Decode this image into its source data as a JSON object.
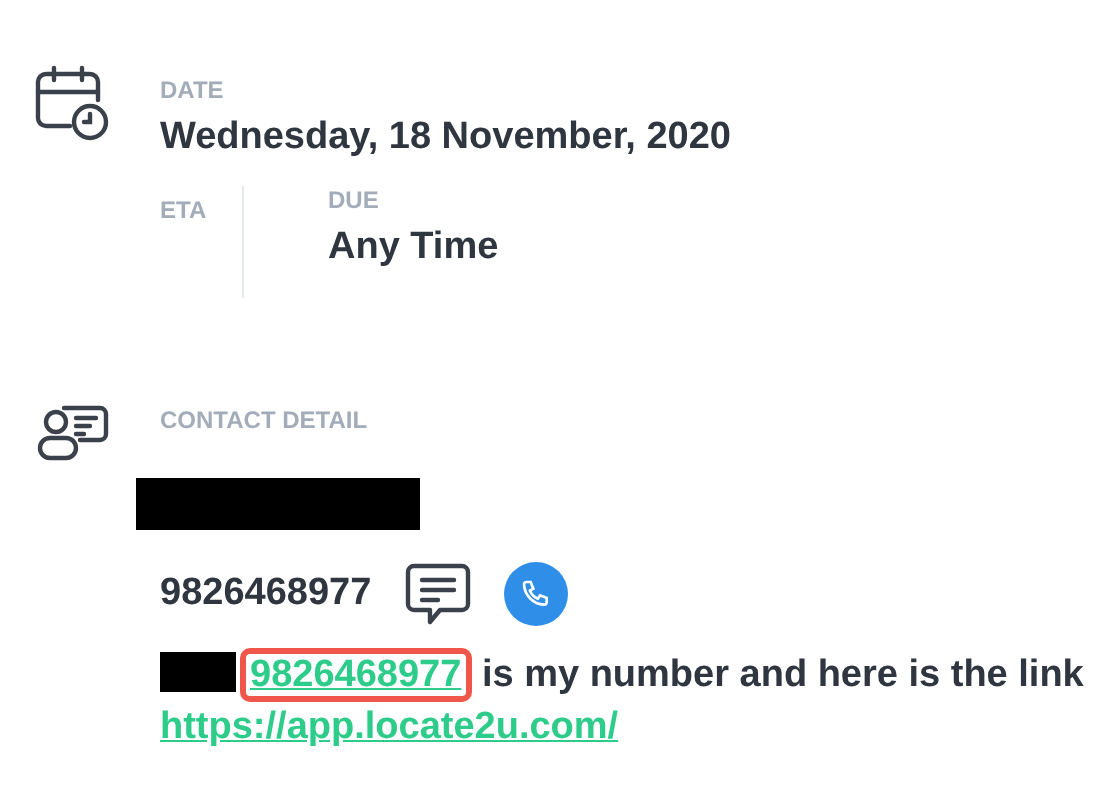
{
  "schedule": {
    "date_label": "DATE",
    "date": "Wednesday, 18 November, 2020",
    "eta_label": "ETA",
    "due_label": "DUE",
    "due": "Any Time"
  },
  "contact": {
    "label": "CONTACT DETAIL",
    "name_redacted": true,
    "phone": "9826468977",
    "message": {
      "prefix_redacted": true,
      "phone_link": "9826468977",
      "phone_link_highlighted": true,
      "text": "is my number and here is the link",
      "url": "https://app.locate2u.com/"
    }
  }
}
